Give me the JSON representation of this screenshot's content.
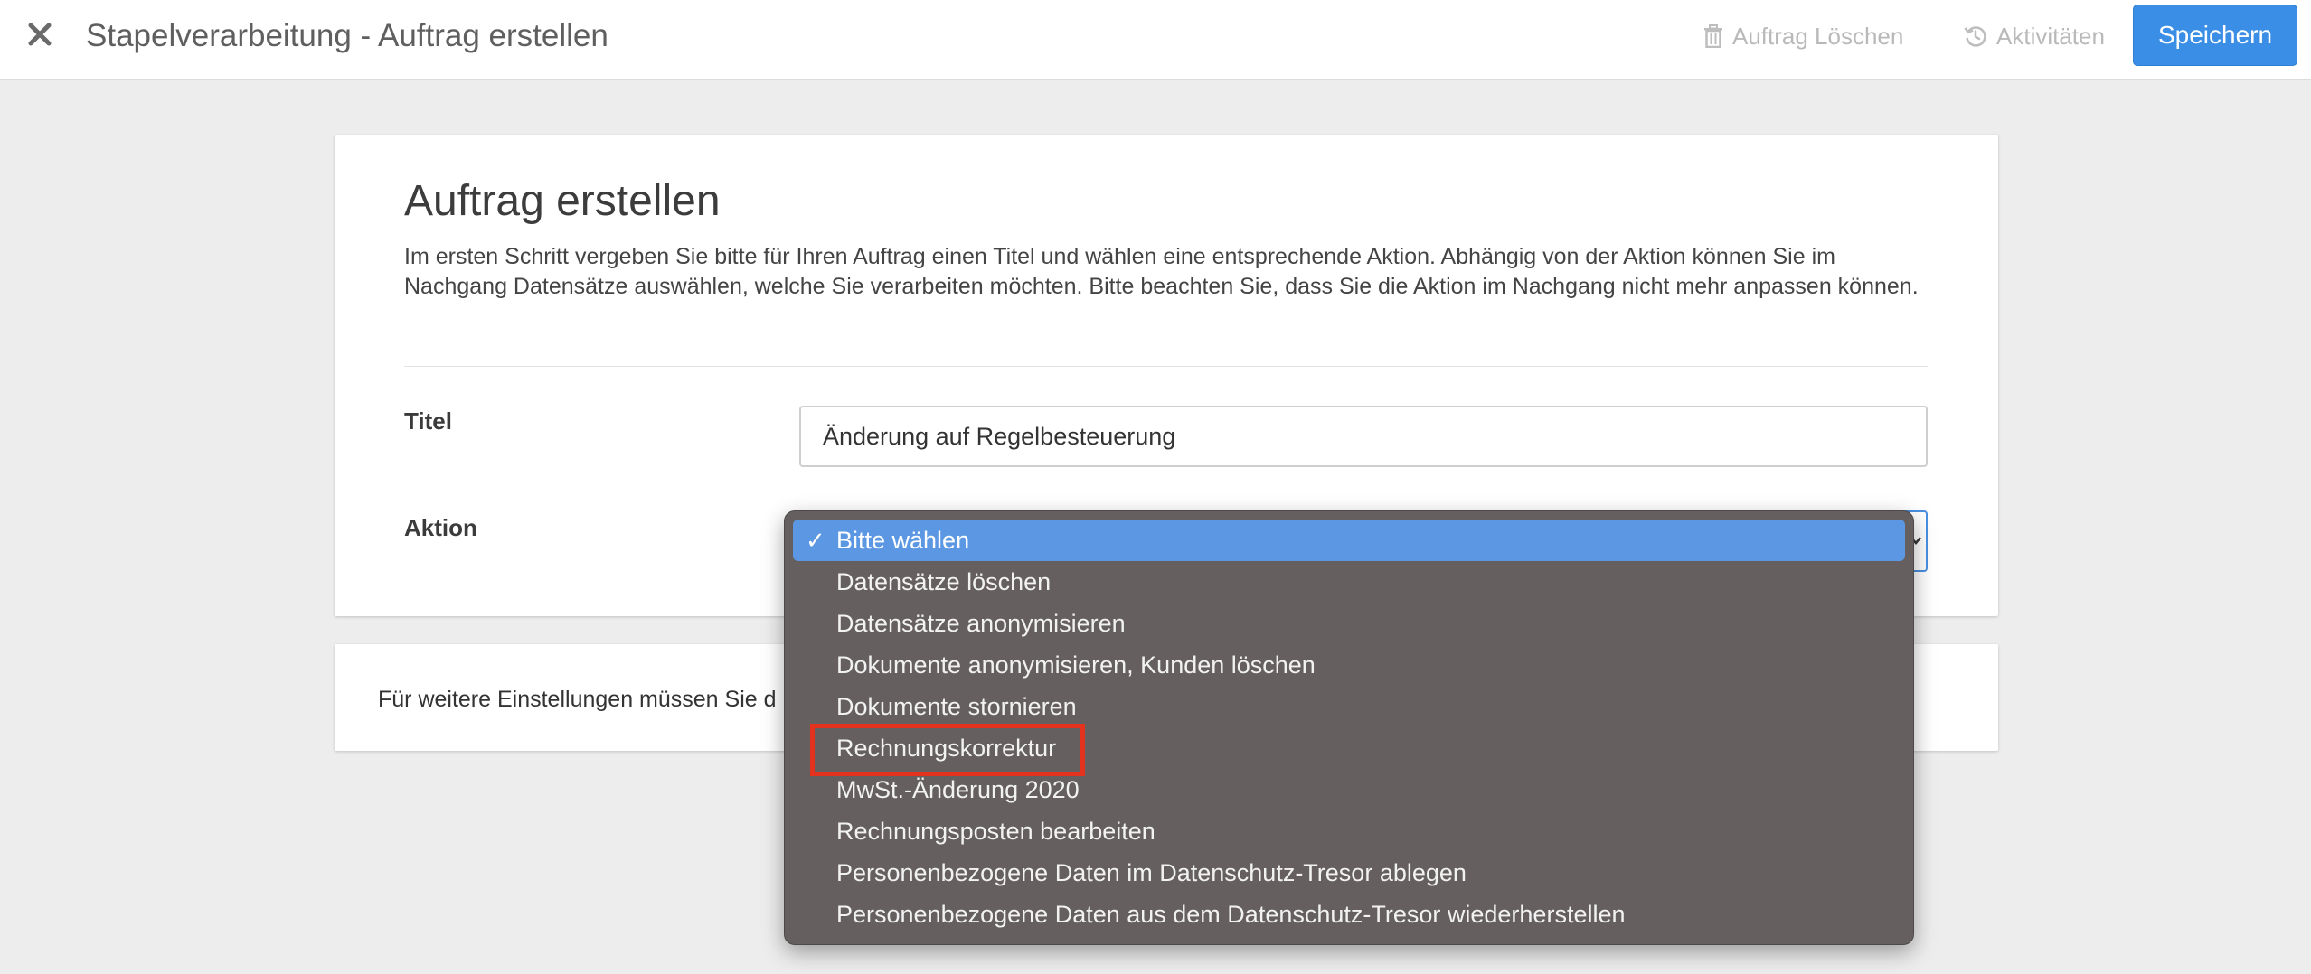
{
  "header": {
    "title": "Stapelverarbeitung - Auftrag erstellen",
    "delete_label": "Auftrag Löschen",
    "activities_label": "Aktivitäten",
    "save_label": "Speichern"
  },
  "form": {
    "heading": "Auftrag erstellen",
    "description": "Im ersten Schritt vergeben Sie bitte für Ihren Auftrag einen Titel und wählen eine entsprechende Aktion. Abhängig von der Aktion können Sie im Nachgang Datensätze auswählen, welche Sie verarbeiten möchten. Bitte beachten Sie, dass Sie die Aktion im Nachgang nicht mehr anpassen können.",
    "title_label": "Titel",
    "title_value": "Änderung auf Regelbesteuerung",
    "action_label": "Aktion"
  },
  "hint": {
    "text": "Für weitere Einstellungen müssen Sie d"
  },
  "dropdown": {
    "check": "✓",
    "options": [
      "Bitte wählen",
      "Datensätze löschen",
      "Datensätze anonymisieren",
      "Dokumente anonymisieren, Kunden löschen",
      "Dokumente stornieren",
      "Rechnungskorrektur",
      "MwSt.-Änderung 2020",
      "Rechnungsposten bearbeiten",
      "Personenbezogene Daten im Datenschutz-Tresor ablegen",
      "Personenbezogene Daten aus dem Datenschutz-Tresor wiederherstellen"
    ],
    "selected_index": 0,
    "highlighted_option": "Rechnungskorrektur"
  },
  "colors": {
    "primary": "#3a8ee6",
    "dropdown_bg": "#65605f",
    "selected_bg": "#5b97e2",
    "highlight_border": "#e3321e"
  }
}
